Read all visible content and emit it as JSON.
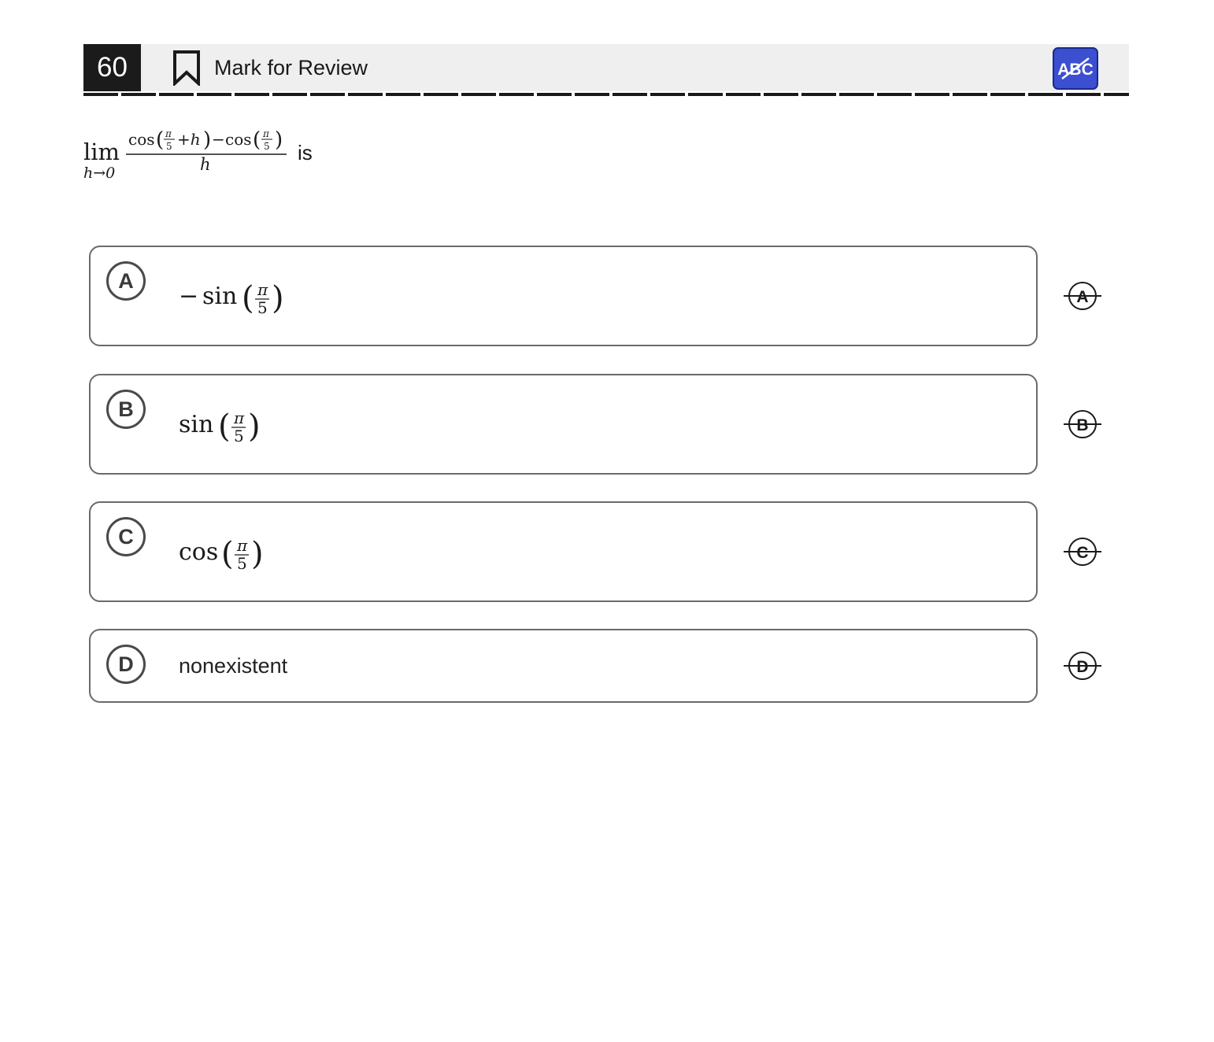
{
  "question": {
    "number": "60",
    "mark_for_review_label": "Mark for Review",
    "abc_tool_label": "ABC",
    "stem": {
      "limit_word": "lim",
      "limit_subscript": "h→0",
      "numerator_cos1": "cos",
      "numerator_pi1": "π",
      "numerator_five1": "5",
      "numerator_plus_h": "+h",
      "numerator_minus": "−",
      "numerator_cos2": "cos",
      "numerator_pi2": "π",
      "numerator_five2": "5",
      "denominator": "h",
      "suffix": "is"
    }
  },
  "choices": [
    {
      "letter": "A",
      "sign": "−",
      "func": "sin",
      "pi": "π",
      "five": "5",
      "eliminate_label": "A"
    },
    {
      "letter": "B",
      "func": "sin",
      "pi": "π",
      "five": "5",
      "eliminate_label": "B"
    },
    {
      "letter": "C",
      "func": "cos",
      "pi": "π",
      "five": "5",
      "eliminate_label": "C"
    },
    {
      "letter": "D",
      "text": "nonexistent",
      "eliminate_label": "D"
    }
  ],
  "colors": {
    "question_number_bg": "#1b1b1b",
    "header_bg": "#efefef",
    "abc_button_bg": "#3b4fd0",
    "choice_border": "#6a6a6a"
  }
}
